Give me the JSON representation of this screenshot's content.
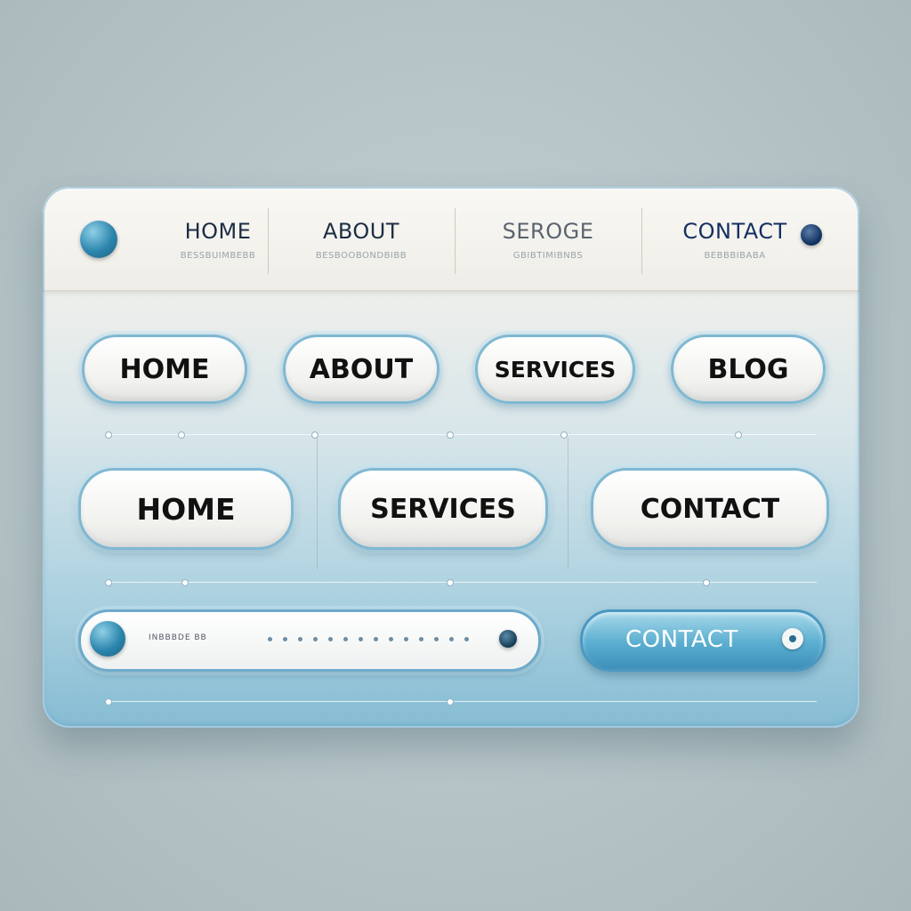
{
  "topnav": {
    "items": [
      {
        "label": "HOME",
        "sublabel": "BESSBUIMBEBB"
      },
      {
        "label": "ABOUT",
        "sublabel": "BESBOOBONDBIBB"
      },
      {
        "label": "SEROGE",
        "sublabel": "GBIBTIMIBNBS"
      },
      {
        "label": "CONTACT",
        "sublabel": "BEBBBIBABA"
      }
    ]
  },
  "buttons_row1": [
    "HOME",
    "ABOUT",
    "SERVICES",
    "BLOG"
  ],
  "buttons_row2": [
    "HOME",
    "SERVICES",
    "CONTACT"
  ],
  "search": {
    "placeholder": "INBBBDE BB"
  },
  "cta": {
    "label": "CONTACT"
  },
  "colors": {
    "accent": "#3d8fb8",
    "panel_top": "#f4f3ef",
    "panel_bottom": "#86bcd3"
  }
}
